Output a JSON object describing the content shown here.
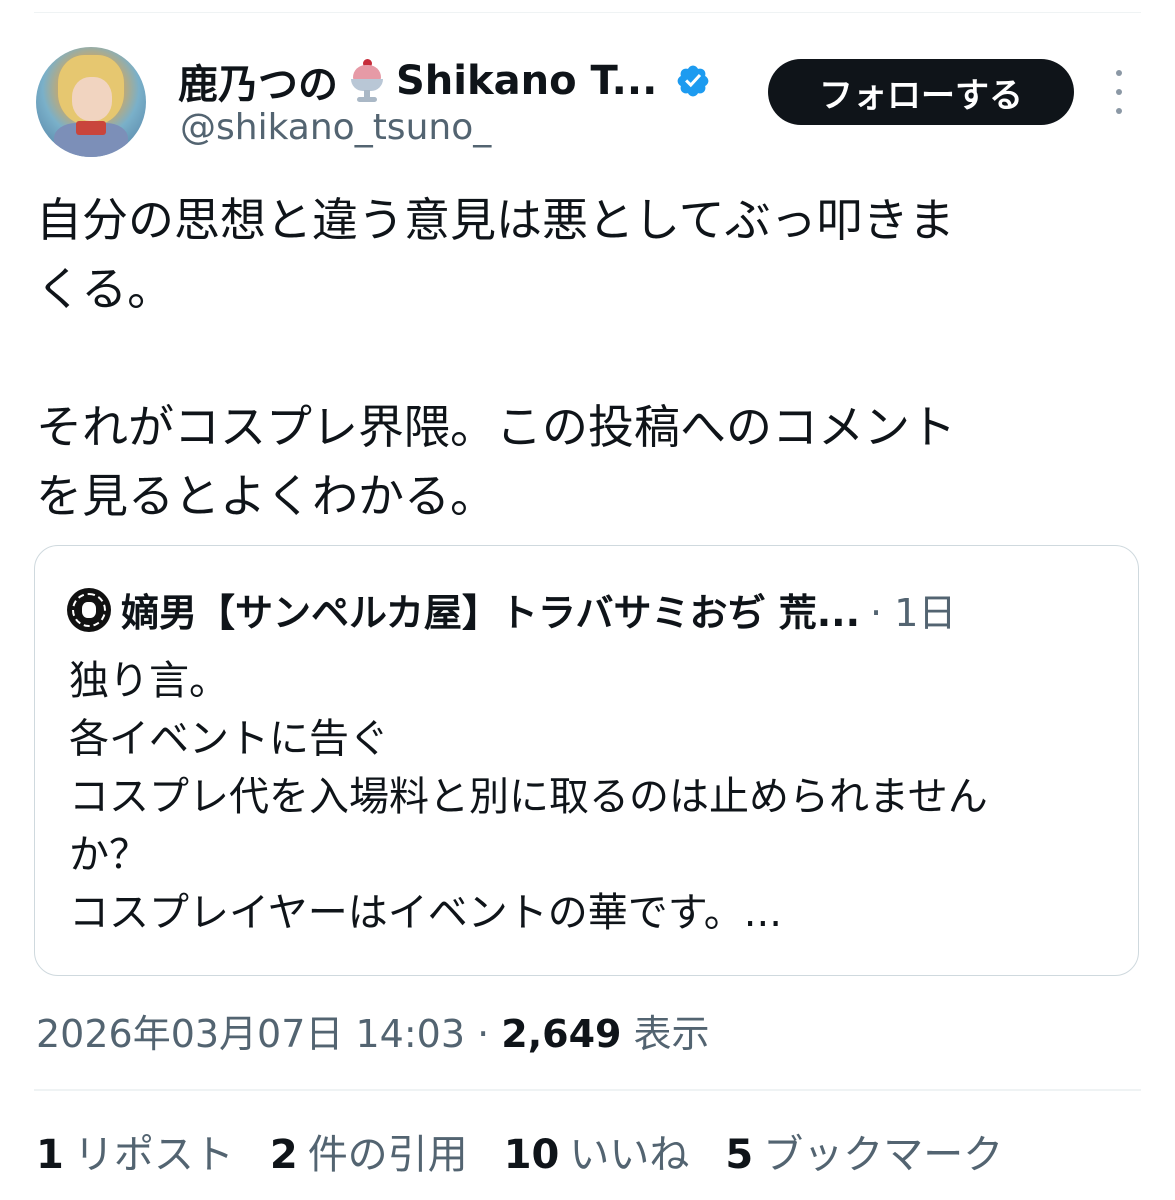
{
  "author": {
    "display_name": "鹿乃つの",
    "name_suffix": "Shikano T...",
    "handle": "@shikano_tsuno_",
    "emoji_icon": "ice-cream-sundae-icon",
    "verified_icon": "verified-badge-icon",
    "verified_color": "#1d9bf0"
  },
  "follow_button": {
    "label": "フォローする"
  },
  "tweet": {
    "lines_p1": [
      "自分の思想と違う意見は悪としてぶっ叩きま",
      "くる。"
    ],
    "lines_p2": [
      "それがコスプレ界隈。この投稿へのコメント",
      "を見るとよくわかる。"
    ]
  },
  "quote": {
    "author_name": "嫡男【サンペルカ屋】トラバサミおぢ 荒...",
    "time": "· 1日",
    "lines": [
      "独り言。",
      "各イベントに告ぐ",
      "コスプレ代を入場料と別に取るのは止められません",
      "か？",
      "コスプレイヤーはイベントの華です。..."
    ]
  },
  "meta": {
    "timestamp": "2026年03月07日 14:03 · ",
    "views_count": "2,649",
    "views_label": " 表示"
  },
  "stats": [
    {
      "count": "1",
      "label": "リポスト"
    },
    {
      "count": "2",
      "label": "件の引用"
    },
    {
      "count": "10",
      "label": "いいね"
    },
    {
      "count": "5",
      "label": "ブックマーク"
    }
  ],
  "colors": {
    "text_primary": "#0f1419",
    "text_secondary": "#536471",
    "border": "#cfd9de",
    "button_bg": "#0f1419"
  }
}
